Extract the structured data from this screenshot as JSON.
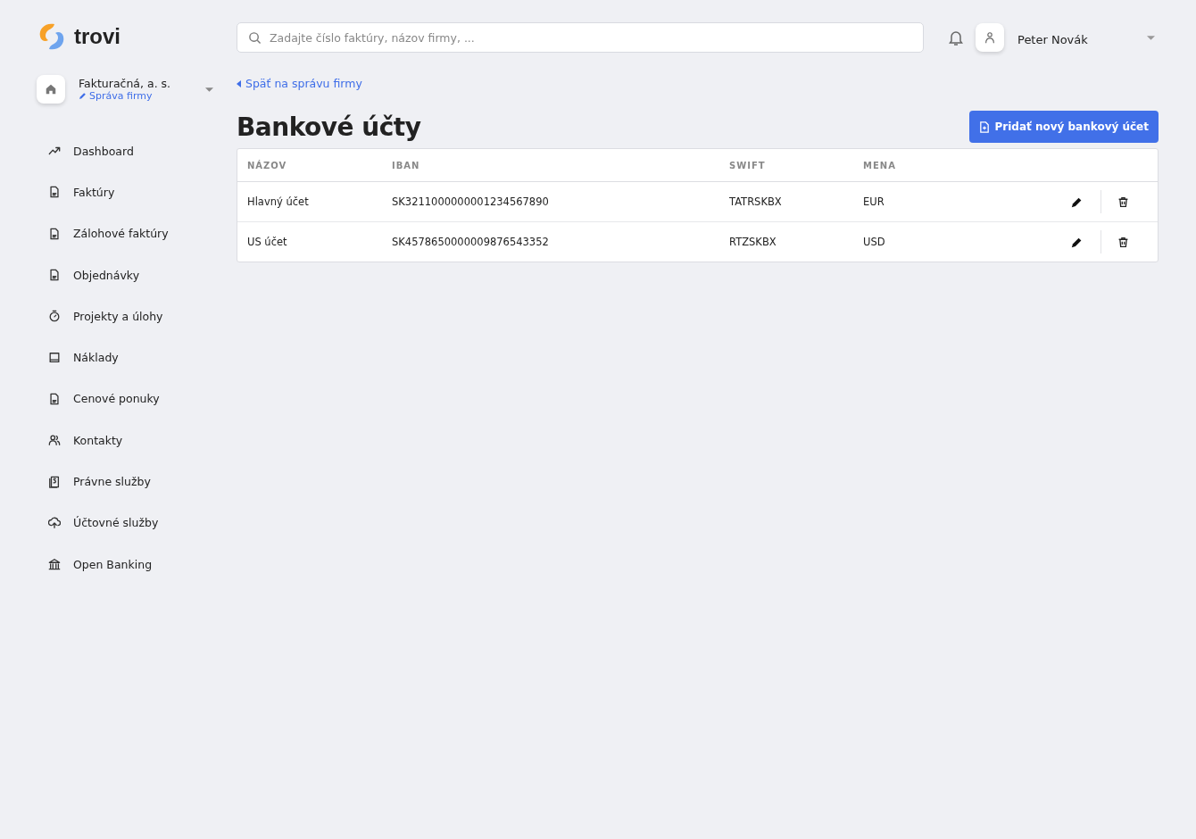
{
  "logo": {
    "name": "trovi"
  },
  "company": {
    "name": "Fakturačná, a. s.",
    "link": "Správa firmy"
  },
  "sidebar": {
    "items": [
      {
        "label": "Dashboard"
      },
      {
        "label": "Faktúry"
      },
      {
        "label": "Zálohové faktúry"
      },
      {
        "label": "Objednávky"
      },
      {
        "label": "Projekty a úlohy"
      },
      {
        "label": "Náklady"
      },
      {
        "label": "Cenové ponuky"
      },
      {
        "label": "Kontakty"
      },
      {
        "label": "Právne služby"
      },
      {
        "label": "Účtovné služby"
      },
      {
        "label": "Open Banking"
      }
    ]
  },
  "search": {
    "placeholder": "Zadajte číslo faktúry, názov firmy, ..."
  },
  "user": {
    "name": "Peter Novák"
  },
  "back_link": "Späť na správu firmy",
  "page_title": "Bankové účty",
  "add_button": "Pridať nový bankový účet",
  "table": {
    "columns": [
      "NÁZOV",
      "IBAN",
      "SWIFT",
      "MENA"
    ],
    "rows": [
      {
        "name": "Hlavný účet",
        "iban": "SK3211000000001234567890",
        "swift": "TATRSKBX",
        "currency": "EUR"
      },
      {
        "name": "US účet",
        "iban": "SK4578650000009876543352",
        "swift": "RTZSKBX",
        "currency": "USD"
      }
    ]
  }
}
